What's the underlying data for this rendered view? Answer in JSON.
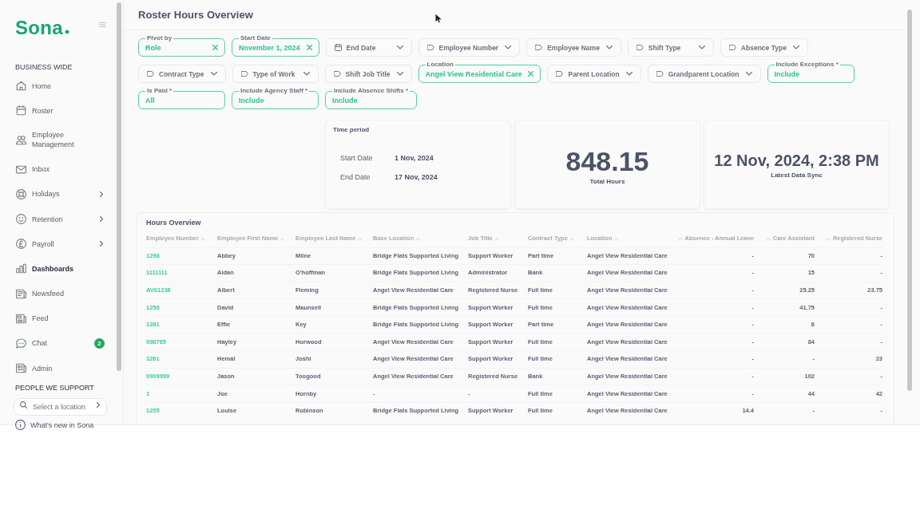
{
  "sidebar": {
    "logo": "Sona",
    "section_title": "BUSINESS WIDE",
    "items": [
      {
        "label": "Home",
        "kind": "link",
        "selected": false
      },
      {
        "label": "Roster",
        "kind": "link",
        "selected": false
      },
      {
        "label": "Employee Management",
        "kind": "link",
        "selected": false
      },
      {
        "label": "Inbox",
        "kind": "link",
        "selected": false
      },
      {
        "label": "Holidays",
        "kind": "menu",
        "selected": false
      },
      {
        "label": "Retention",
        "kind": "menu",
        "selected": false
      },
      {
        "label": "Payroll",
        "kind": "menu",
        "selected": false
      },
      {
        "label": "Dashboards",
        "kind": "link",
        "selected": true
      },
      {
        "label": "Newsfeed",
        "kind": "link",
        "selected": false
      },
      {
        "label": "Feed",
        "kind": "link",
        "selected": false
      },
      {
        "label": "Chat",
        "kind": "link",
        "selected": false,
        "badge": "2"
      },
      {
        "label": "Admin",
        "kind": "link",
        "selected": false
      }
    ],
    "people_title": "PEOPLE WE SUPPORT",
    "location_search": {
      "placeholder": "Select a location"
    },
    "footer_link": "What's new in Sona"
  },
  "page": {
    "title": "Roster Hours Overview"
  },
  "filter_rows": [
    [
      {
        "kind": "filled",
        "label": "Pivot by",
        "value": "Role",
        "clearable": true
      },
      {
        "kind": "filled",
        "label": "Start Date",
        "value": "November 1, 2024",
        "clearable": true
      },
      {
        "kind": "date",
        "label": "End Date"
      },
      {
        "kind": "select",
        "label": "Employee Number"
      },
      {
        "kind": "select",
        "label": "Employee Name"
      },
      {
        "kind": "select",
        "label": "Shift Type"
      },
      {
        "kind": "select",
        "label": "Absence Type"
      }
    ],
    [
      {
        "kind": "select",
        "label": "Contract Type"
      },
      {
        "kind": "select",
        "label": "Type of Work"
      },
      {
        "kind": "select",
        "label": "Shift Job Title"
      },
      {
        "kind": "filled",
        "label": "Location",
        "value": "Angel View Residential Care",
        "clearable": true
      },
      {
        "kind": "select",
        "label": "Parent Location"
      },
      {
        "kind": "select",
        "label": "Grandparent Location"
      },
      {
        "kind": "filled",
        "label": "Include Exceptions *",
        "value": "Include",
        "clearable": false
      }
    ],
    [
      {
        "kind": "filled",
        "label": "Is Paid *",
        "value": "All",
        "clearable": false
      },
      {
        "kind": "filled",
        "label": "Include Agency Staff *",
        "value": "Include",
        "clearable": false
      },
      {
        "kind": "filled",
        "label": "Include Absence Shifts *",
        "value": "Include",
        "clearable": false
      }
    ]
  ],
  "time_period": {
    "title": "Time period",
    "rows": [
      {
        "label": "Start Date",
        "value": "1 Nov, 2024"
      },
      {
        "label": "End Date",
        "value": "17 Nov, 2024"
      }
    ]
  },
  "stats": [
    {
      "kind": "large",
      "value": "848.15",
      "label": "Total Hours"
    },
    {
      "kind": "medium",
      "value": "12 Nov, 2024, 2:38 PM",
      "label": "Latest Data Sync"
    }
  ],
  "table": {
    "title": "Hours Overview",
    "columns": [
      {
        "label": "Employee Number",
        "kind": "link"
      },
      {
        "label": "Employee First Name",
        "kind": "text"
      },
      {
        "label": "Employee Last Name",
        "kind": "text"
      },
      {
        "label": "Base Location",
        "kind": "text"
      },
      {
        "label": "Job Title",
        "kind": "text"
      },
      {
        "label": "Contract Type",
        "kind": "text"
      },
      {
        "label": "Location",
        "kind": "text"
      },
      {
        "label": "Absence - Annual Leave",
        "kind": "number"
      },
      {
        "label": "Care Assistant",
        "kind": "number"
      },
      {
        "label": "Registered Nurse",
        "kind": "number"
      }
    ],
    "rows": [
      [
        "1298",
        "Abbey",
        "Milne",
        "Bridge Flats Supported Living",
        "Support Worker",
        "Part time",
        "Angel View Residential Care",
        "-",
        "70",
        "-"
      ],
      [
        "1111111",
        "Aidan",
        "O'hoffman",
        "Bridge Flats Supported Living",
        "Administrator",
        "Bank",
        "Angel View Residential Care",
        "-",
        "15",
        "-"
      ],
      [
        "AV01236",
        "Albert",
        "Fleming",
        "Angel View Residential Care",
        "Registered Nurse",
        "Full time",
        "Angel View Residential Care",
        "-",
        "25.25",
        "23.75"
      ],
      [
        "1258",
        "David",
        "Maunsell",
        "Bridge Flats Supported Living",
        "Support Worker",
        "Full time",
        "Angel View Residential Care",
        "-",
        "41.75",
        "-"
      ],
      [
        "1281",
        "Effie",
        "Key",
        "Bridge Flats Supported Living",
        "Support Worker",
        "Part time",
        "Angel View Residential Care",
        "-",
        "6",
        "-"
      ],
      [
        "098765",
        "Hayley",
        "Horwood",
        "Angel View Residential Care",
        "Support Worker",
        "Full time",
        "Angel View Residential Care",
        "-",
        "84",
        "-"
      ],
      [
        "1261",
        "Hemal",
        "Joshi",
        "Angel View Residential Care",
        "Support Worker",
        "Full time",
        "Angel View Residential Care",
        "-",
        "-",
        "23"
      ],
      [
        "0909999",
        "Jason",
        "Toogood",
        "Angel View Residential Care",
        "Registered Nurse",
        "Bank",
        "Angel View Residential Care",
        "-",
        "102",
        "-"
      ],
      [
        "1",
        "Joe",
        "Hornby",
        "-",
        "-",
        "Full time",
        "Angel View Residential Care",
        "-",
        "44",
        "42"
      ],
      [
        "1255",
        "Louise",
        "Robinson",
        "Bridge Flats Supported Living",
        "Support Worker",
        "Full time",
        "Angel View Residential Care",
        "14.4",
        "-",
        "-"
      ]
    ]
  }
}
